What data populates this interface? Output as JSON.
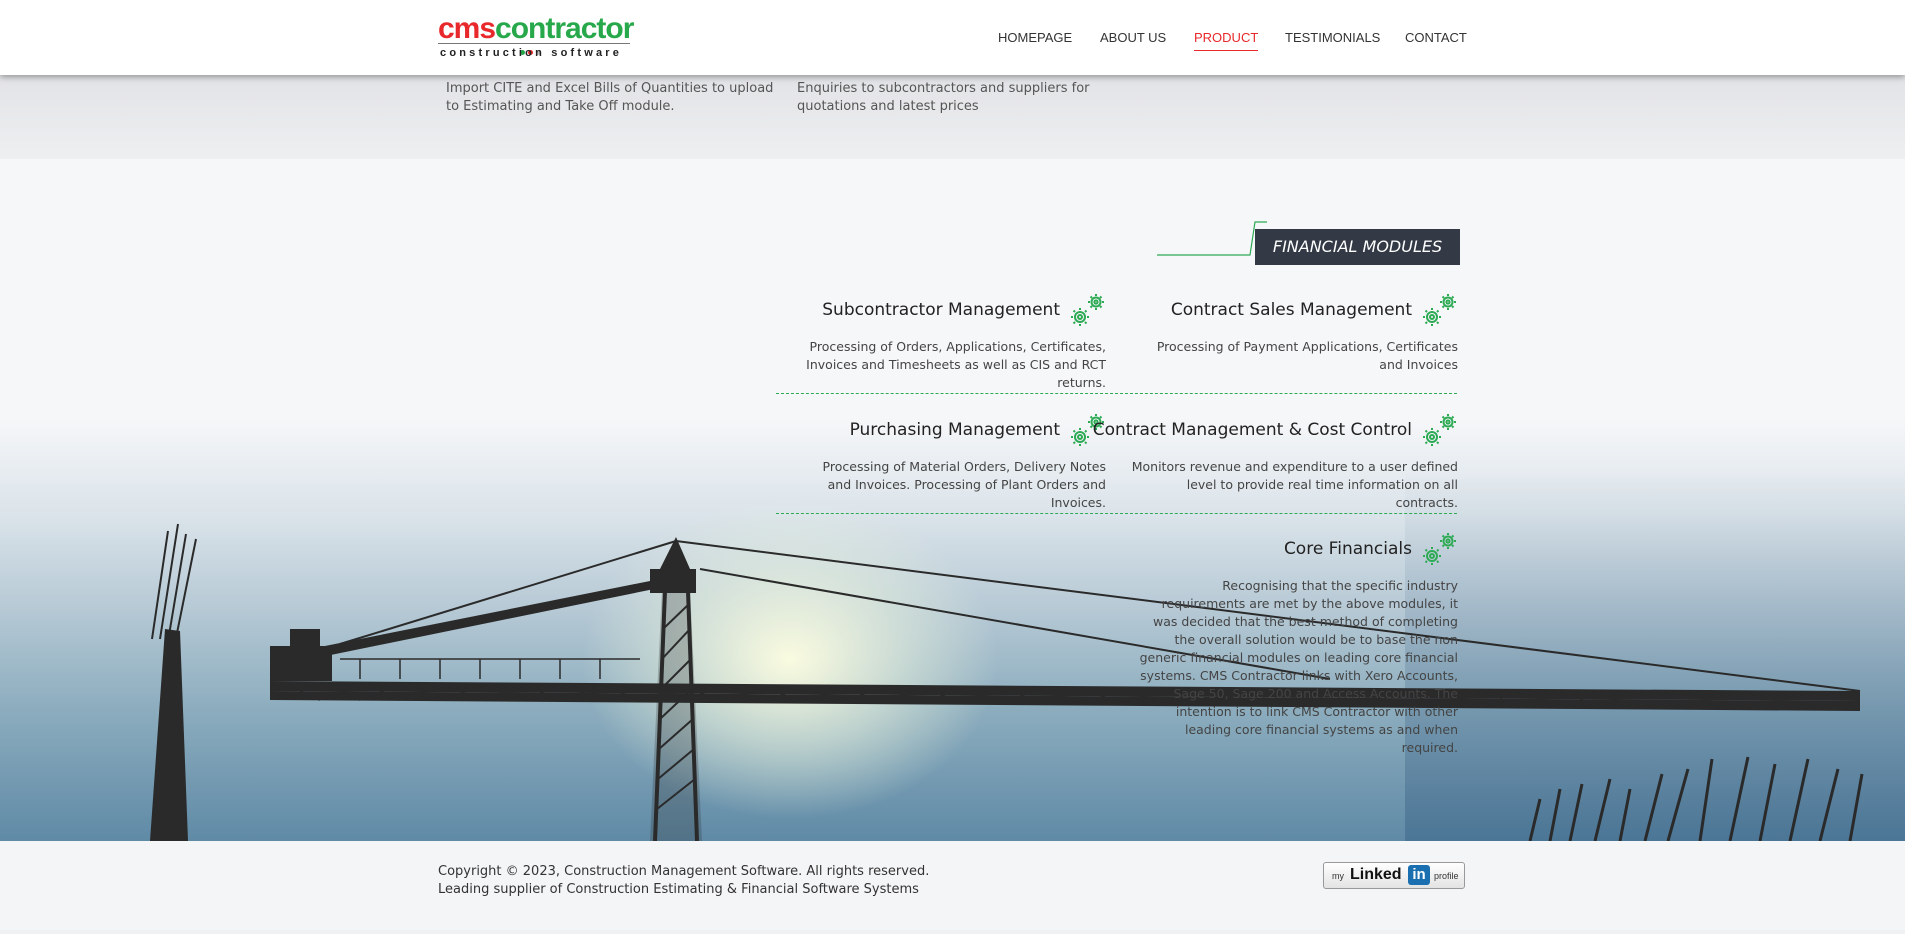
{
  "brand": {
    "logo_part1": "cms",
    "logo_part2": "contractor",
    "tagline": "construction software",
    "colors": {
      "red": "#e8282b",
      "green": "#27a84a",
      "dark": "#333a45"
    }
  },
  "nav": {
    "items": [
      {
        "label": "HOMEPAGE",
        "active": false
      },
      {
        "label": "ABOUT US",
        "active": false
      },
      {
        "label": "PRODUCT",
        "active": true
      },
      {
        "label": "TESTIMONIALS",
        "active": false
      },
      {
        "label": "CONTACT",
        "active": false
      }
    ]
  },
  "top_strip": {
    "items": [
      {
        "text": "Import CITE and Excel Bills of Quantities to upload to Estimating and Take Off module."
      },
      {
        "text": "Enquiries to subcontractors and suppliers for quotations and latest prices"
      }
    ]
  },
  "financial": {
    "heading": "FINANCIAL MODULES",
    "modules": [
      {
        "title": "Subcontractor Management",
        "description": "Processing of Orders, Applications, Certificates, Invoices and Timesheets as well as CIS and RCT returns.",
        "icon": "gears-icon"
      },
      {
        "title": "Contract Sales Management",
        "description": "Processing of Payment Applications, Certificates and Invoices",
        "icon": "gears-icon"
      },
      {
        "title": "Purchasing Management",
        "description": "Processing of Material Orders, Delivery Notes and Invoices. Processing of Plant Orders and Invoices.",
        "icon": "gears-icon"
      },
      {
        "title": "Contract Management & Cost Control",
        "description": "Monitors revenue and expenditure to a user defined level to provide real time information on all contracts.",
        "icon": "gears-icon"
      },
      {
        "title": "Core Financials",
        "description": "Recognising that the specific industry requirements are met by the above modules, it was decided that the best method of completing the overall solution would be to base the non generic financial modules on leading core financial systems. CMS Contractor links with Xero Accounts, Sage 50, Sage 200 and Access Accounts. The intention is to link CMS Contractor with other leading core financial systems as and when required.",
        "icon": "gears-icon"
      }
    ]
  },
  "footer": {
    "copyright": "Copyright © 2023, Construction Management Software. All rights reserved.",
    "tagline": "Leading supplier of Construction Estimating & Financial Software Systems",
    "linkedin": {
      "my": "my",
      "linked": "Linked",
      "in": "in",
      "profile": "profile"
    }
  }
}
